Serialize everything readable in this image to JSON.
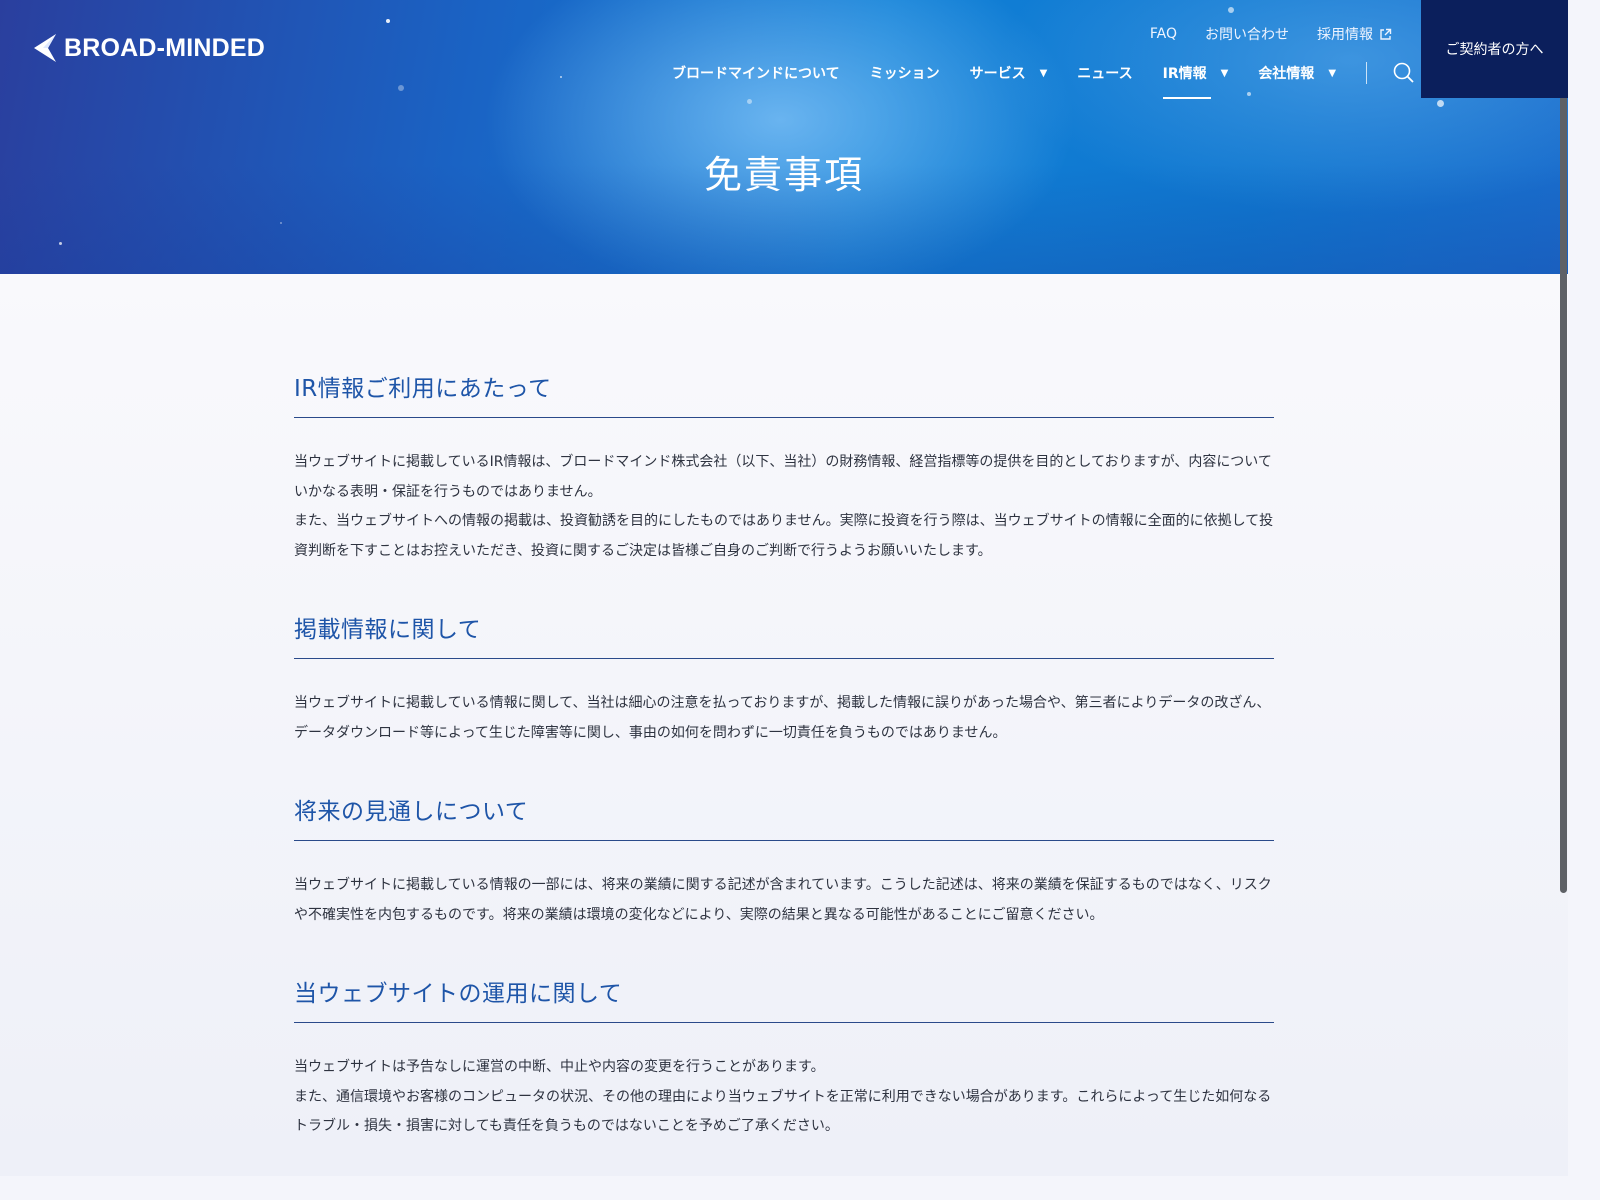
{
  "header": {
    "logo_text": "BROAD-MINDED",
    "utility_links": [
      {
        "label": "FAQ"
      },
      {
        "label": "お問い合わせ"
      },
      {
        "label": "採用情報",
        "icon": "external-link-icon"
      }
    ],
    "nav": [
      {
        "label": "ブロードマインドについて",
        "has_dropdown": false
      },
      {
        "label": "ミッション",
        "has_dropdown": false
      },
      {
        "label": "サービス",
        "has_dropdown": true
      },
      {
        "label": "ニュース",
        "has_dropdown": false
      },
      {
        "label": "IR情報",
        "has_dropdown": true,
        "active": true
      },
      {
        "label": "会社情報",
        "has_dropdown": true
      }
    ],
    "search_icon": "search-icon",
    "contract_button": "ご契約者の方へ"
  },
  "hero": {
    "title": "免責事項"
  },
  "sections": [
    {
      "heading": "IR情報ご利用にあたって",
      "paragraphs": [
        "当ウェブサイトに掲載しているIR情報は、ブロードマインド株式会社（以下、当社）の財務情報、経営指標等の提供を目的としておりますが、内容についていかなる表明・保証を行うものではありません。",
        "また、当ウェブサイトへの情報の掲載は、投資勧誘を目的にしたものではありません。実際に投資を行う際は、当ウェブサイトの情報に全面的に依拠して投資判断を下すことはお控えいただき、投資に関するご決定は皆様ご自身のご判断で行うようお願いいたします。"
      ]
    },
    {
      "heading": "掲載情報に関して",
      "paragraphs": [
        "当ウェブサイトに掲載している情報に関して、当社は細心の注意を払っておりますが、掲載した情報に誤りがあった場合や、第三者によりデータの改ざん、データダウンロード等によって生じた障害等に関し、事由の如何を問わずに一切責任を負うものではありません。"
      ]
    },
    {
      "heading": "将来の見通しについて",
      "paragraphs": [
        "当ウェブサイトに掲載している情報の一部には、将来の業績に関する記述が含まれています。こうした記述は、将来の業績を保証するものではなく、リスクや不確実性を内包するものです。将来の業績は環境の変化などにより、実際の結果と異なる可能性があることにご留意ください。"
      ]
    },
    {
      "heading": "当ウェブサイトの運用に関して",
      "paragraphs": [
        "当ウェブサイトは予告なしに運営の中断、中止や内容の変更を行うことがあります。",
        "また、通信環境やお客様のコンピュータの状況、その他の理由により当ウェブサイトを正常に利用できない場合があります。これらによって生じた如何なるトラブル・損失・損害に対しても責任を負うものではないことを予めご了承ください。"
      ]
    }
  ],
  "colors": {
    "heading_blue": "#1e55a8",
    "contract_button_bg": "#0b1f5c",
    "body_text": "#2e3340"
  }
}
